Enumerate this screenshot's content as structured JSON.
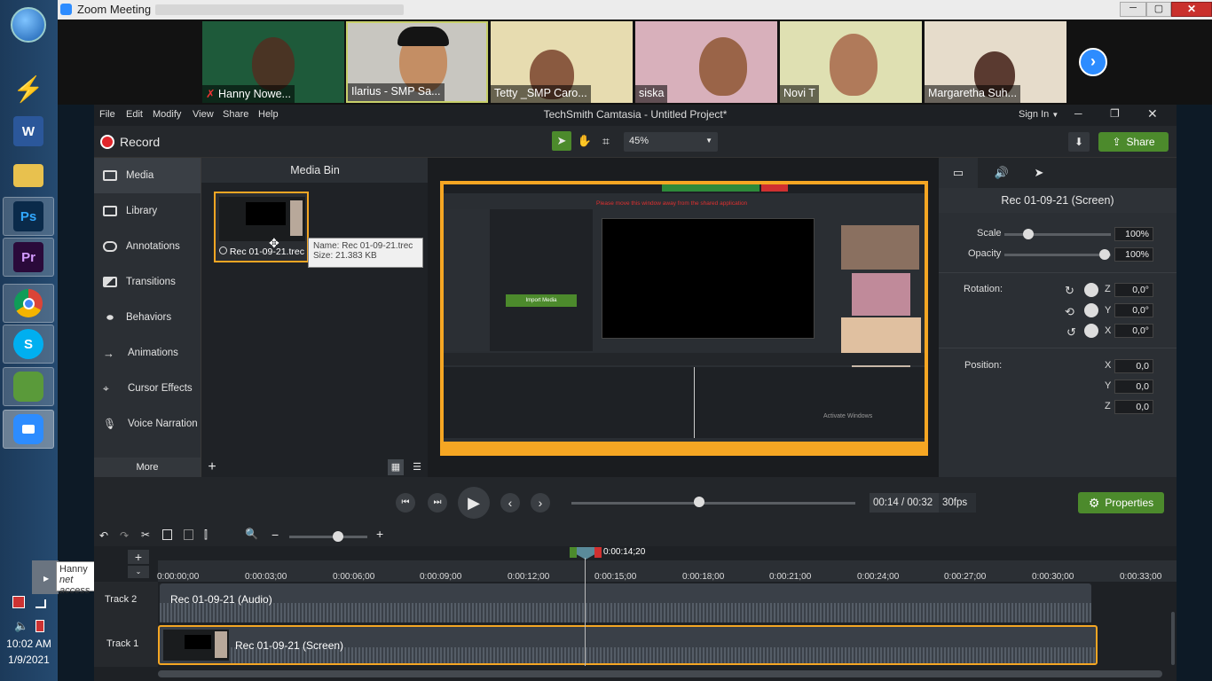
{
  "taskbar": {
    "clock_time": "10:02 AM",
    "clock_date": "1/9/2021",
    "tooltip_line1": "Hanny",
    "tooltip_line2": "net access",
    "apps": [
      {
        "name": "start-icon"
      },
      {
        "name": "winamp-icon"
      },
      {
        "name": "word-icon",
        "label": "W"
      },
      {
        "name": "folder-icon"
      },
      {
        "name": "photoshop-icon",
        "label": "Ps"
      },
      {
        "name": "premiere-icon",
        "label": "Pr"
      },
      {
        "name": "chrome-icon"
      },
      {
        "name": "skype-icon",
        "label": "S"
      },
      {
        "name": "camtasia-icon"
      },
      {
        "name": "zoom-icon"
      }
    ]
  },
  "zoom": {
    "window_title": "Zoom Meeting",
    "participants": [
      "Hanny Nowe...",
      "Ilarius - SMP Sa...",
      "Tetty _SMP Caro...",
      "siska",
      "Novi T",
      "Margaretha Suh..."
    ]
  },
  "camtasia": {
    "menu": [
      "File",
      "Edit",
      "Modify",
      "View",
      "Share",
      "Help"
    ],
    "title": "TechSmith Camtasia - Untitled Project*",
    "sign_in": "Sign In",
    "record_label": "Record",
    "zoom_level": "45%",
    "share_label": "Share",
    "nav_items": [
      "Media",
      "Library",
      "Annotations",
      "Transitions",
      "Behaviors",
      "Animations",
      "Cursor Effects",
      "Voice Narration"
    ],
    "more_label": "More",
    "media_bin_title": "Media Bin",
    "clip_name": "Rec 01-09-21.trec",
    "tooltip_name": "Name: Rec 01-09-21.trec",
    "tooltip_size": "Size: 21.383 KB",
    "props_title": "Rec 01-09-21 (Screen)",
    "scale_label": "Scale",
    "scale_value": "100%",
    "opacity_label": "Opacity",
    "opacity_value": "100%",
    "rotation_label": "Rotation:",
    "rot_z": "0,0°",
    "rot_y": "0,0°",
    "rot_x": "0,0°",
    "position_label": "Position:",
    "pos_x": "0,0",
    "pos_y": "0,0",
    "pos_z": "0,0",
    "axis_z": "Z",
    "axis_y": "Y",
    "axis_x": "X",
    "time_display": "00:14 / 00:32",
    "fps": "30fps",
    "properties_label": "Properties",
    "playhead_time": "0:00:14;20",
    "ruler": [
      "0:00:00;00",
      "0:00:03;00",
      "0:00:06;00",
      "0:00:09;00",
      "0:00:12;00",
      "0:00:15;00",
      "0:00:18;00",
      "0:00:21;00",
      "0:00:24;00",
      "0:00:27;00",
      "0:00:30;00",
      "0:00:33;00"
    ],
    "track2_label": "Track 2",
    "track1_label": "Track 1",
    "track2_clip": "Rec 01-09-21 (Audio)",
    "track1_clip": "Rec 01-09-21 (Screen)",
    "preview_warning": "Please move this window away from the shared application",
    "preview_import": "Import Media",
    "preview_activate": "Activate Windows"
  },
  "colors": {
    "accent_green": "#4c8a2c",
    "record_red": "#e0262b",
    "selection_orange": "#f5a623"
  }
}
